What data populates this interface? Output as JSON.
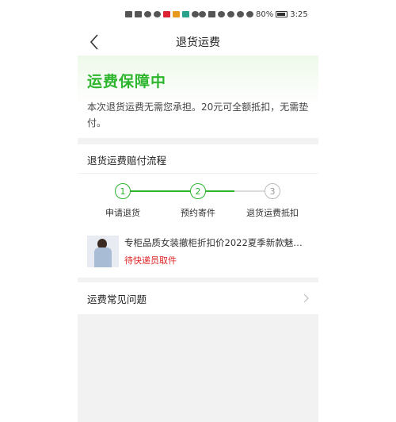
{
  "status_bar": {
    "battery": "80%",
    "time": "3:25"
  },
  "nav": {
    "title": "退货运费"
  },
  "guarantee": {
    "title": "运费保障中",
    "description": "本次退货运费无需您承担。20元可全额抵扣，无需垫付。"
  },
  "process": {
    "title": "退货运费赔付流程",
    "steps": [
      {
        "number": "1",
        "label": "申请退货",
        "done": true
      },
      {
        "number": "2",
        "label": "预约寄件",
        "done": true
      },
      {
        "number": "3",
        "label": "退货运费抵扣",
        "done": false
      }
    ]
  },
  "order": {
    "name": "专柜品质女装撤柜折扣价2022夏季新款魅…",
    "status": "待快递员取件"
  },
  "faq": {
    "label": "运费常见问题"
  },
  "colors": {
    "accent_green": "#2db52d",
    "status_red": "#d22222"
  }
}
